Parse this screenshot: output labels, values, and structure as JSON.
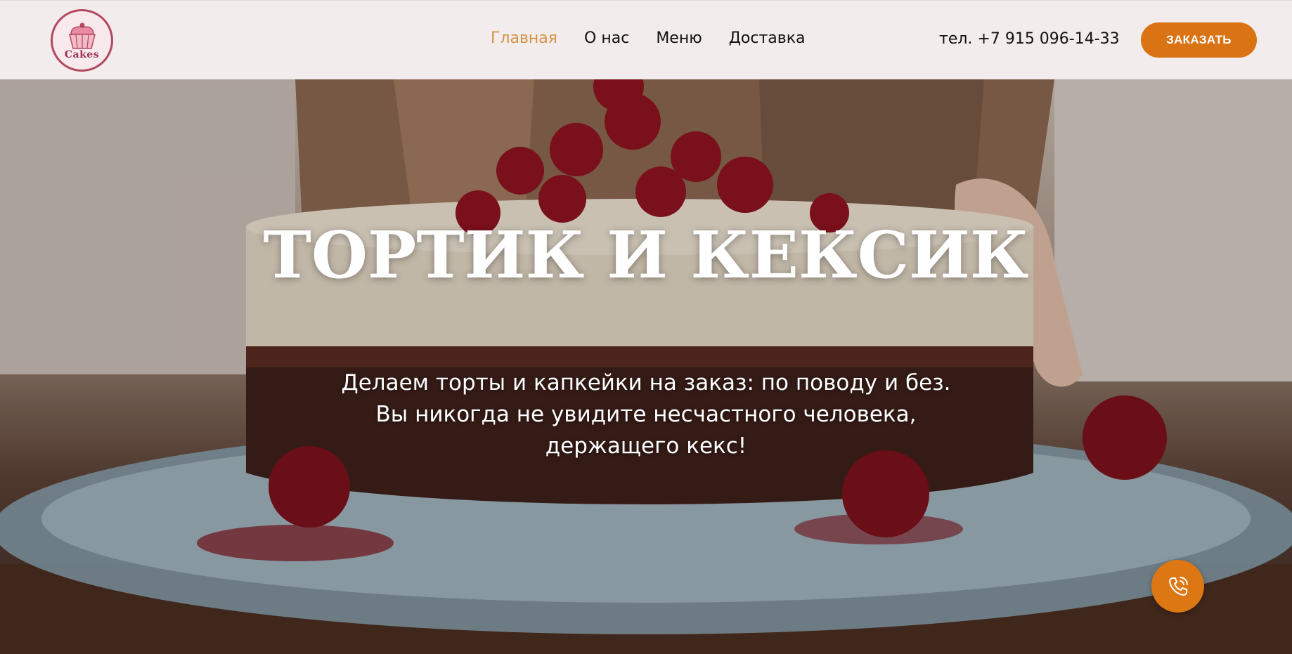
{
  "brand": {
    "logo_text": "Cakes",
    "logo_icon": "cupcake-icon"
  },
  "nav": {
    "items": [
      {
        "label": "Главная",
        "active": true
      },
      {
        "label": "О нас",
        "active": false
      },
      {
        "label": "Меню",
        "active": false
      },
      {
        "label": "Доставка",
        "active": false
      }
    ]
  },
  "header": {
    "phone": "тел. +7 915 096-14-33",
    "order_button": "ЗАКАЗАТЬ"
  },
  "hero": {
    "title": "ТОРТИК И КЕКСИК",
    "subtitle_lines": [
      "Делаем торты и капкейки на заказ: по поводу и без.",
      "Вы никогда не увидите несчастного человека,",
      "держащего кекс!"
    ]
  },
  "floating": {
    "call_icon": "phone-call-icon"
  },
  "colors": {
    "accent": "#d97314",
    "active_nav": "#d49245",
    "header_bg": "#f3ecec",
    "logo": "#b2485e"
  }
}
